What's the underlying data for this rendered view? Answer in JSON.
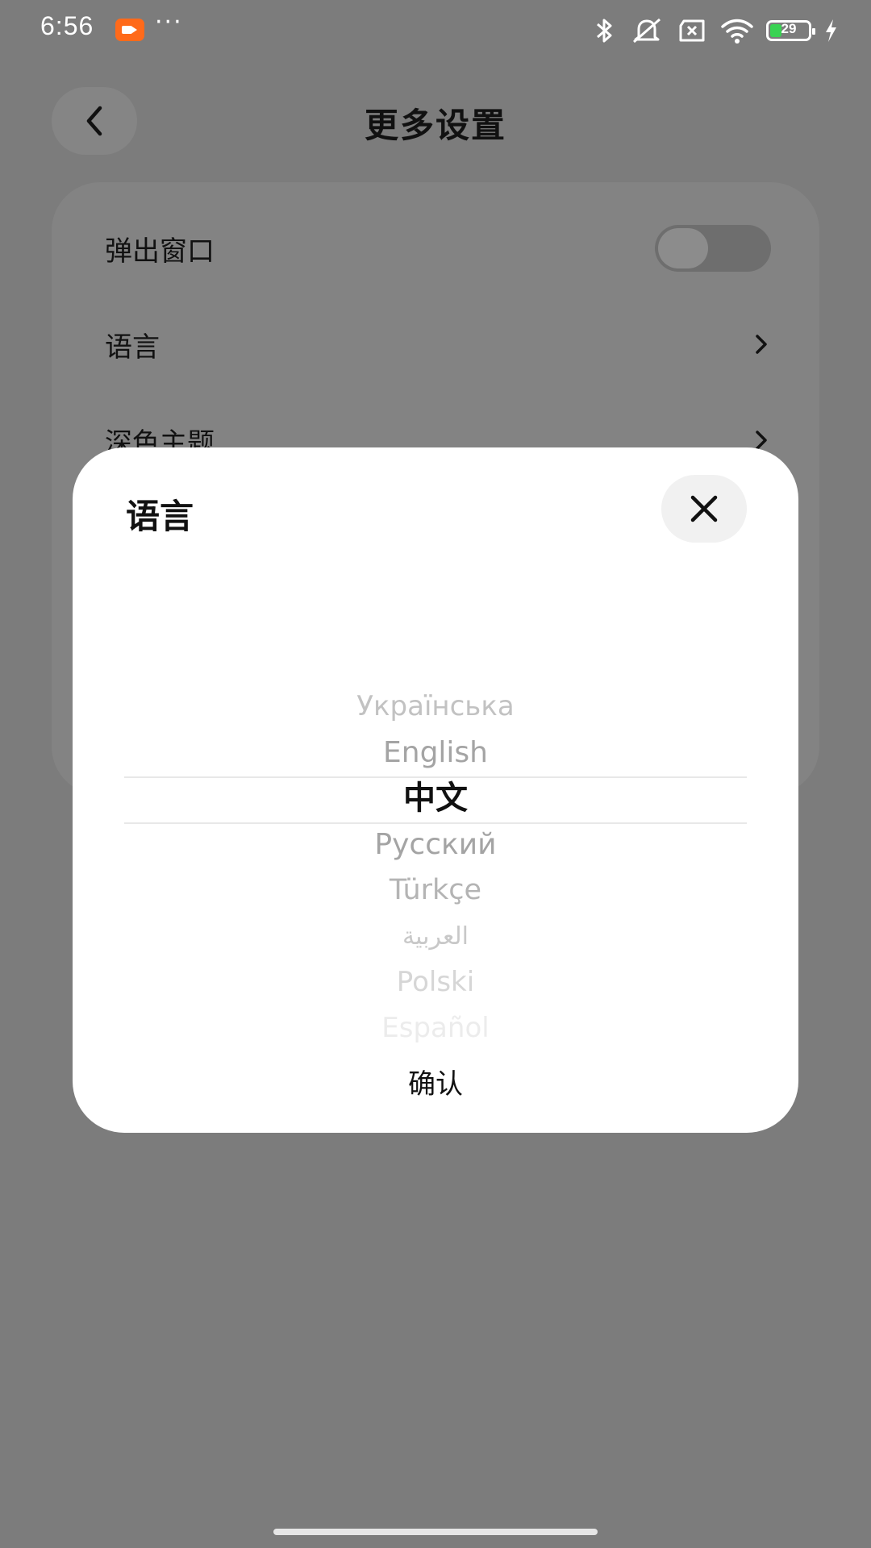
{
  "status_bar": {
    "time": "6:56",
    "more": "···",
    "battery_level": "29",
    "icons": [
      "screen-record-icon",
      "bluetooth-icon",
      "mute-icon",
      "sim-off-icon",
      "wifi-icon",
      "battery-icon",
      "charging-icon"
    ]
  },
  "header": {
    "title": "更多设置",
    "back_icon": "chevron-left-icon"
  },
  "settings": {
    "popup_label": "弹出窗口",
    "popup_enabled": false,
    "language_label": "语言",
    "dark_theme_label": "深色主题"
  },
  "dialog": {
    "title": "语言",
    "close_icon": "close-icon",
    "options": [
      "Українська",
      "English",
      "中文",
      "Русский",
      "Türkçe",
      "العربية",
      "Polski",
      "Español"
    ],
    "selected": "中文",
    "confirm_label": "确认"
  },
  "colors": {
    "overlay": "#7c7c7c",
    "selected_text": "#111111",
    "accent_record": "#ff6a1a",
    "battery_fill": "#39d353"
  }
}
